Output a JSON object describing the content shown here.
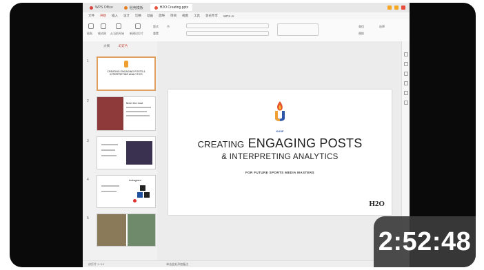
{
  "video": {
    "duration": "2:52:48"
  },
  "window": {
    "tabs": [
      {
        "label": "WPS Office",
        "active": false
      },
      {
        "label": "稻壳模板",
        "active": false
      },
      {
        "label": "H2O Creating.pptx",
        "active": true
      }
    ]
  },
  "menu": {
    "items": [
      "文件",
      "开始",
      "插入",
      "设计",
      "切换",
      "动画",
      "放映",
      "审阅",
      "视图",
      "工具",
      "会员专享",
      "WPS AI"
    ],
    "active_index": 1
  },
  "ribbon": {
    "labels": [
      "粘贴",
      "格式刷",
      "从当前开始",
      "新建幻灯片",
      "版式",
      "重置",
      "节",
      "查找",
      "替换",
      "选择"
    ]
  },
  "sidebar": {
    "tabs": [
      "大纲",
      "幻灯片"
    ],
    "thumbnails": [
      {
        "num": "1",
        "title": "CREATING ENGAGING POSTS & INTERPRETING ANALYTICS"
      },
      {
        "num": "2",
        "title": "Meet the host"
      },
      {
        "num": "3",
        "title": ""
      },
      {
        "num": "4",
        "title": "Instagram"
      },
      {
        "num": "5",
        "title": ""
      }
    ]
  },
  "slide": {
    "logo_text": "KUSF",
    "title_small": "CREATING",
    "title_large": "ENGAGING POSTS",
    "title_line2": "& INTERPRETING ANALYTICS",
    "subtitle": "FOR FUTURE SPORTS MEDIA MASTERS",
    "brand": "H2O"
  },
  "status": {
    "left": "幻灯片 1 / 12",
    "notes": "单击此处添加备注"
  },
  "colors": {
    "accent": "#c0392b",
    "thumb_highlight": "#e0a060",
    "duration_bg": "#3c3c3c"
  }
}
